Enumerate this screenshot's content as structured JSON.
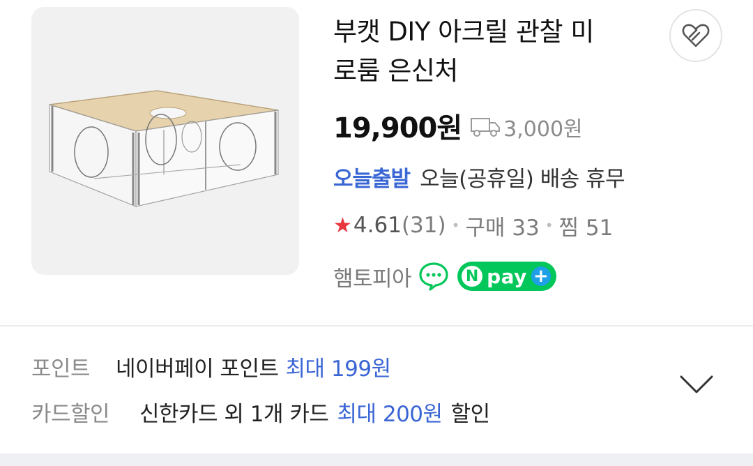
{
  "product": {
    "title_line1": "부캣 DIY 아크릴 관찰 미",
    "title_line2": "로룸 은신처",
    "price": "19,900원",
    "shipping_fee": "3,000원",
    "delivery_badge": "오늘출발",
    "delivery_text": "오늘(공휴일) 배송 휴무",
    "rating": "4.61",
    "review_count": "(31)",
    "purchase_count": "구매 33",
    "wish_count": "찜 51",
    "seller": "햄토피아",
    "npay_n": "N",
    "npay_label": "pay"
  },
  "benefits": {
    "point_label": "포인트",
    "point_text": "네이버페이 포인트",
    "point_highlight": "최대 199원",
    "card_label": "카드할인",
    "card_text": "신한카드 외 1개 카드",
    "card_highlight": "최대 200원",
    "card_suffix": "할인"
  },
  "icons": {
    "wish": "heart-outline-icon",
    "shipping": "truck-icon",
    "talk": "talk-chat-icon",
    "expand": "chevron-down-icon",
    "rating": "star-icon"
  },
  "colors": {
    "accent_blue": "#3a66d4",
    "star_red": "#e9363e",
    "npay_green": "#03c75a"
  }
}
